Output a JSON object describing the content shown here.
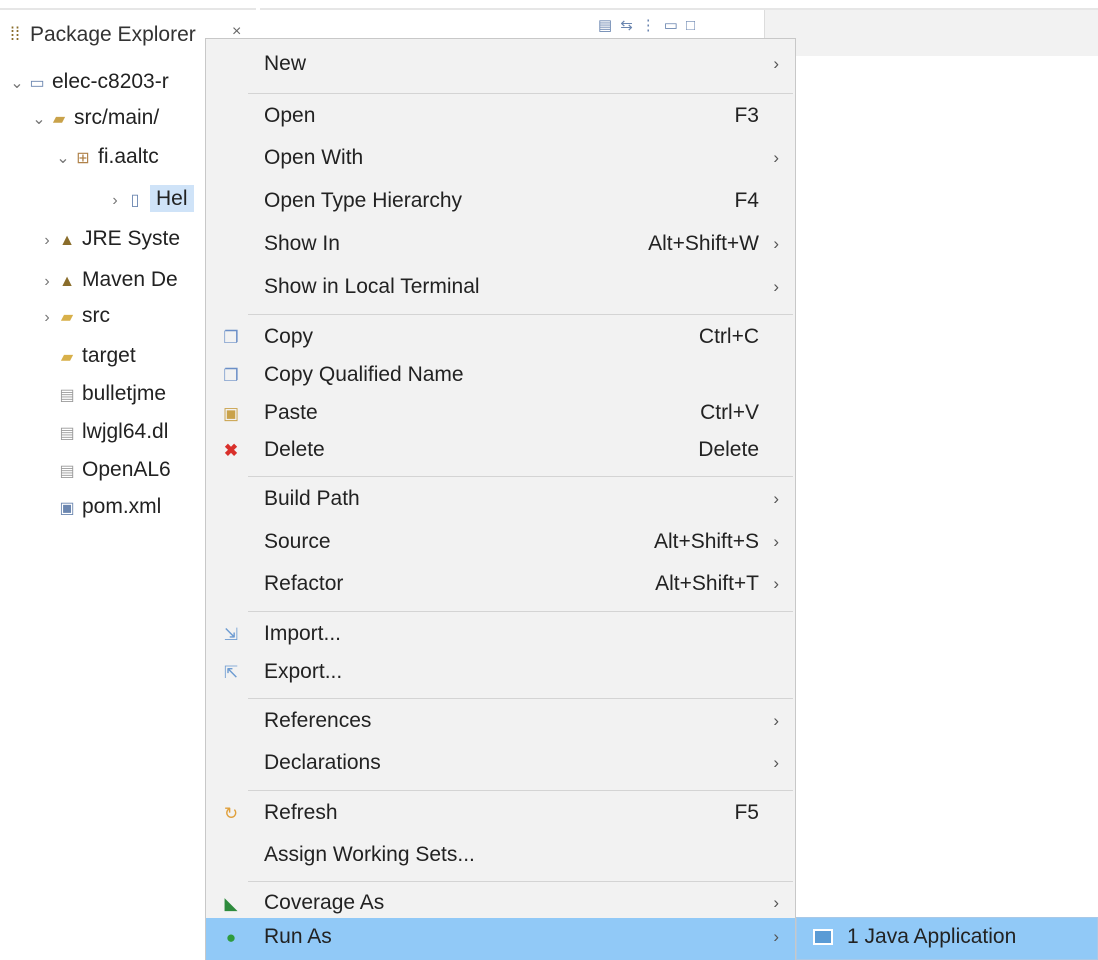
{
  "explorer": {
    "tab_icon": "package-explorer-icon",
    "tab_label": "Package Explorer",
    "tab_close": "×",
    "items": [
      {
        "chevron": "v",
        "icon": "java-project-icon",
        "label": "elec-c8203-r"
      },
      {
        "chevron": "v",
        "icon": "source-folder-icon",
        "label": "src/main/"
      },
      {
        "chevron": "v",
        "icon": "package-icon",
        "label": "fi.aaltc"
      },
      {
        "chevron": ">",
        "icon": "java-file-icon",
        "label": "Hel"
      },
      {
        "chevron": ">",
        "icon": "library-icon",
        "label": "JRE Syste"
      },
      {
        "chevron": ">",
        "icon": "library-icon",
        "label": "Maven De"
      },
      {
        "chevron": ">",
        "icon": "folder-icon",
        "label": "src"
      },
      {
        "chevron": "",
        "icon": "folder-icon",
        "label": "target"
      },
      {
        "chevron": "",
        "icon": "file-icon",
        "label": "bulletjme"
      },
      {
        "chevron": "",
        "icon": "file-icon",
        "label": "lwjgl64.dl"
      },
      {
        "chevron": "",
        "icon": "file-icon",
        "label": "OpenAL6"
      },
      {
        "chevron": "",
        "icon": "xml-file-icon",
        "label": "pom.xml"
      }
    ]
  },
  "toolbar": {
    "icons": [
      "collapse-all-icon",
      "link-with-editor-icon",
      "view-menu-icon",
      "minimize-icon",
      "maximize-icon"
    ]
  },
  "context_menu": {
    "items": [
      {
        "label": "New",
        "shortcut": "",
        "submenu": true,
        "icon": ""
      },
      {
        "label": "Open",
        "shortcut": "F3",
        "submenu": false,
        "icon": ""
      },
      {
        "label": "Open With",
        "shortcut": "",
        "submenu": true,
        "icon": ""
      },
      {
        "label": "Open Type Hierarchy",
        "shortcut": "F4",
        "submenu": false,
        "icon": ""
      },
      {
        "label": "Show In",
        "shortcut": "Alt+Shift+W",
        "submenu": true,
        "icon": ""
      },
      {
        "label": "Show in Local Terminal",
        "shortcut": "",
        "submenu": true,
        "icon": ""
      },
      {
        "label": "Copy",
        "shortcut": "Ctrl+C",
        "submenu": false,
        "icon": "copy-icon"
      },
      {
        "label": "Copy Qualified Name",
        "shortcut": "",
        "submenu": false,
        "icon": "copy-qualified-name-icon"
      },
      {
        "label": "Paste",
        "shortcut": "Ctrl+V",
        "submenu": false,
        "icon": "paste-icon"
      },
      {
        "label": "Delete",
        "shortcut": "Delete",
        "submenu": false,
        "icon": "delete-icon"
      },
      {
        "label": "Build Path",
        "shortcut": "",
        "submenu": true,
        "icon": ""
      },
      {
        "label": "Source",
        "shortcut": "Alt+Shift+S",
        "submenu": true,
        "icon": ""
      },
      {
        "label": "Refactor",
        "shortcut": "Alt+Shift+T",
        "submenu": true,
        "icon": ""
      },
      {
        "label": "Import...",
        "shortcut": "",
        "submenu": false,
        "icon": "import-icon"
      },
      {
        "label": "Export...",
        "shortcut": "",
        "submenu": false,
        "icon": "export-icon"
      },
      {
        "label": "References",
        "shortcut": "",
        "submenu": true,
        "icon": ""
      },
      {
        "label": "Declarations",
        "shortcut": "",
        "submenu": true,
        "icon": ""
      },
      {
        "label": "Refresh",
        "shortcut": "F5",
        "submenu": false,
        "icon": "refresh-icon"
      },
      {
        "label": "Assign Working Sets...",
        "shortcut": "",
        "submenu": false,
        "icon": ""
      },
      {
        "label": "Coverage As",
        "shortcut": "",
        "submenu": true,
        "icon": "coverage-icon"
      },
      {
        "label": "Run As",
        "shortcut": "",
        "submenu": true,
        "icon": "run-icon",
        "highlighted": true
      }
    ]
  },
  "submenu": {
    "icon": "java-application-icon",
    "label": "1 Java Application"
  },
  "colors": {
    "menu_bg": "#f2f2f2",
    "highlight": "#91c9f7",
    "selection": "#cfe3f8"
  }
}
